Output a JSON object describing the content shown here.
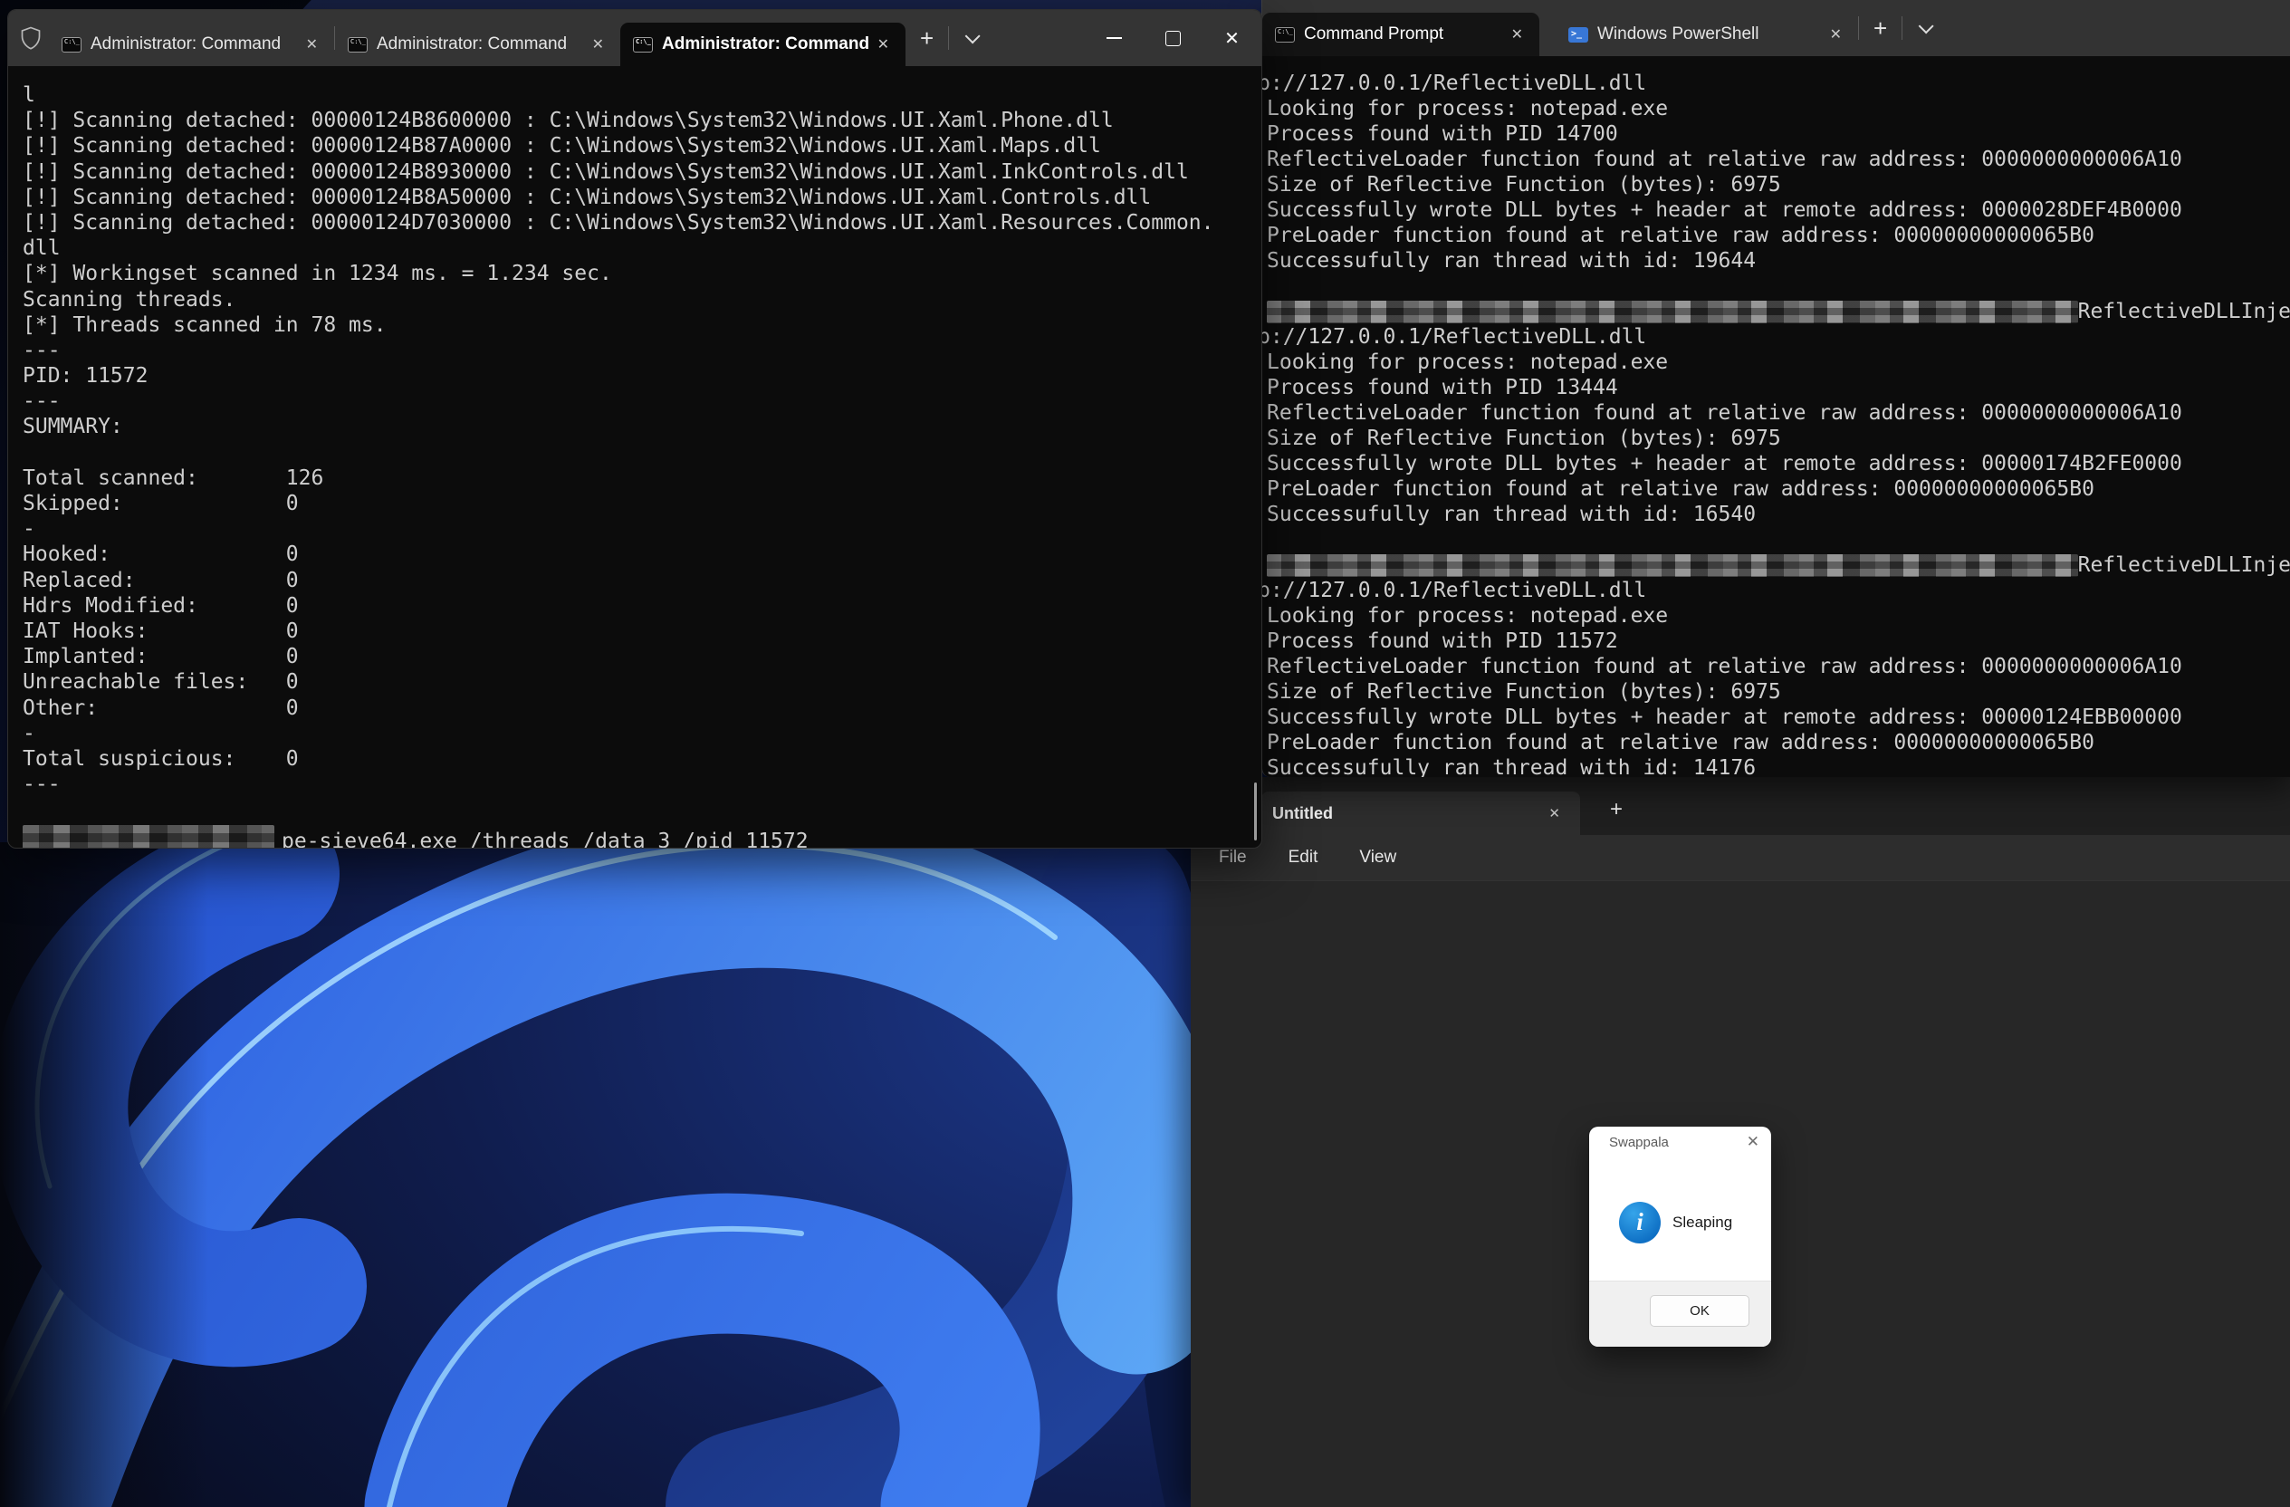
{
  "icons": {
    "close": "✕",
    "plus": "+",
    "cmd_text": "C:\\_",
    "ps_text": ">_"
  },
  "left_terminal": {
    "tabs": [
      {
        "label": "Administrator: Command"
      },
      {
        "label": "Administrator: Command"
      },
      {
        "label": "Administrator: Command"
      }
    ],
    "lines": [
      "l",
      "[!] Scanning detached: 00000124B8600000 : C:\\Windows\\System32\\Windows.UI.Xaml.Phone.dll",
      "[!] Scanning detached: 00000124B87A0000 : C:\\Windows\\System32\\Windows.UI.Xaml.Maps.dll",
      "[!] Scanning detached: 00000124B8930000 : C:\\Windows\\System32\\Windows.UI.Xaml.InkControls.dll",
      "[!] Scanning detached: 00000124B8A50000 : C:\\Windows\\System32\\Windows.UI.Xaml.Controls.dll",
      "[!] Scanning detached: 00000124D7030000 : C:\\Windows\\System32\\Windows.UI.Xaml.Resources.Common.",
      "dll",
      "[*] Workingset scanned in 1234 ms. = 1.234 sec.",
      "Scanning threads.",
      "[*] Threads scanned in 78 ms.",
      "---",
      "PID: 11572",
      "---",
      "SUMMARY:",
      "",
      "Total scanned:       126",
      "Skipped:             0",
      "-",
      "Hooked:              0",
      "Replaced:            0",
      "Hdrs Modified:       0",
      "IAT Hooks:           0",
      "Implanted:           0",
      "Unreachable files:   0",
      "Other:               0",
      "-",
      "Total suspicious:    0",
      "---",
      ""
    ],
    "prompt_line": {
      "redacted_prefix": true,
      "command": "pe-sieve64.exe /threads /data 3 /pid 11572"
    }
  },
  "right_terminal": {
    "tabs": [
      {
        "label": "Command Prompt"
      },
      {
        "label": "Windows PowerShell"
      }
    ],
    "lines": [
      {
        "clip": true,
        "text": "p://127.0.0.1/ReflectiveDLL.dll"
      },
      "Looking for process: notepad.exe",
      "Process found with PID 14700",
      "ReflectiveLoader function found at relative raw address: 0000000000006A10",
      "Size of Reflective Function (bytes): 6975",
      "Successfully wrote DLL bytes + header at remote address: 0000028DEF4B0000",
      "PreLoader function found at relative raw address: 00000000000065B0",
      "Successufully ran thread with id: 19644",
      "",
      {
        "redacted": true,
        "right_text": "ReflectiveDLLInje"
      },
      {
        "clip": true,
        "text": "p://127.0.0.1/ReflectiveDLL.dll"
      },
      "Looking for process: notepad.exe",
      "Process found with PID 13444",
      "ReflectiveLoader function found at relative raw address: 0000000000006A10",
      "Size of Reflective Function (bytes): 6975",
      "Successfully wrote DLL bytes + header at remote address: 00000174B2FE0000",
      "PreLoader function found at relative raw address: 00000000000065B0",
      "Successufully ran thread with id: 16540",
      "",
      {
        "redacted": true,
        "right_text": "ReflectiveDLLInje"
      },
      {
        "clip": true,
        "text": "p://127.0.0.1/ReflectiveDLL.dll"
      },
      "Looking for process: notepad.exe",
      "Process found with PID 11572",
      "ReflectiveLoader function found at relative raw address: 0000000000006A10",
      "Size of Reflective Function (bytes): 6975",
      "Successfully wrote DLL bytes + header at remote address: 00000124EBB00000",
      "PreLoader function found at relative raw address: 00000000000065B0",
      "Successufully ran thread with id: 14176"
    ]
  },
  "notepad": {
    "tab_title": "Untitled",
    "menu": [
      "File",
      "Edit",
      "View"
    ]
  },
  "dialog": {
    "title": "Swappala",
    "message": "Sleaping",
    "icon_glyph": "i",
    "ok_label": "OK"
  }
}
